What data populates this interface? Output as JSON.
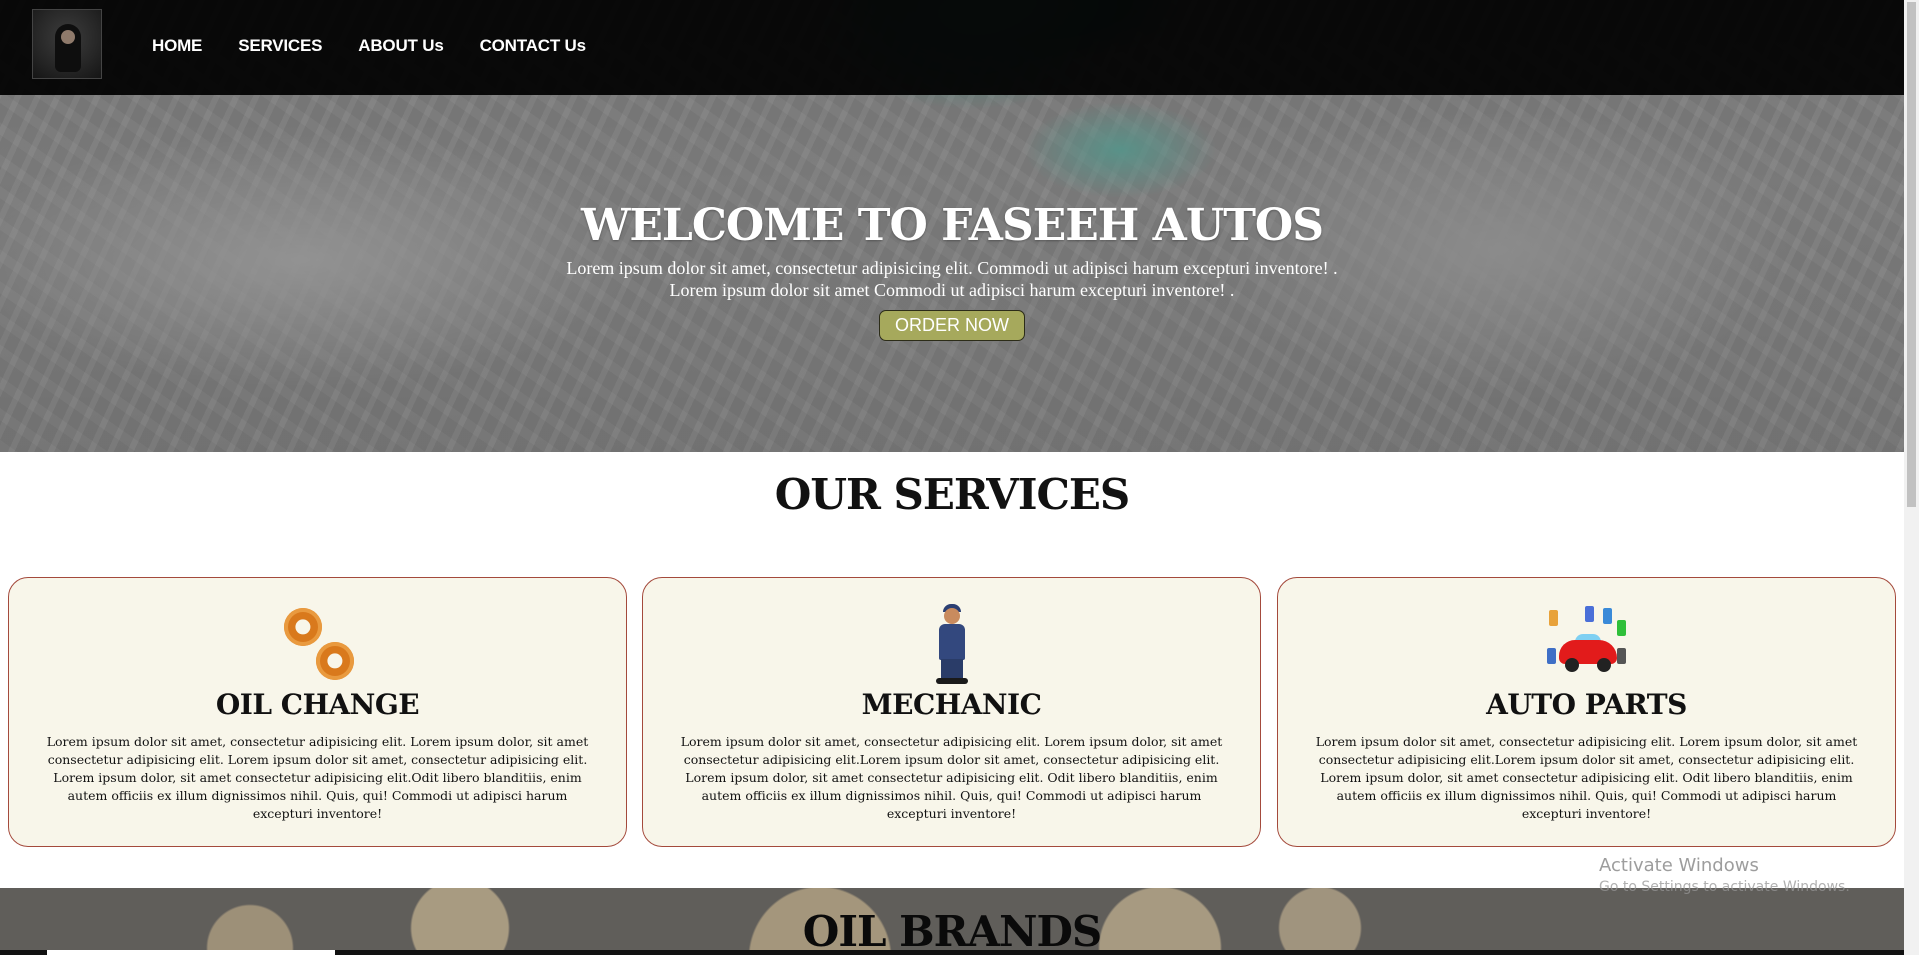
{
  "nav": {
    "items": [
      {
        "label": "HOME"
      },
      {
        "label": "SERVICES"
      },
      {
        "label": "ABOUT Us"
      },
      {
        "label": "CONTACT Us"
      }
    ]
  },
  "hero": {
    "title": "WELCOME TO FASEEH AUTOS",
    "line1": "Lorem ipsum dolor sit amet, consectetur adipisicing elit. Commodi ut adipisci harum excepturi inventore! .",
    "line2": "Lorem ipsum dolor sit amet Commodi ut adipisci harum excepturi inventore! .",
    "button": "ORDER NOW"
  },
  "services": {
    "title": "OUR SERVICES",
    "cards": [
      {
        "icon": "gears-icon",
        "title": "OIL CHANGE",
        "text": "Lorem ipsum dolor sit amet, consectetur adipisicing elit. Lorem ipsum dolor, sit amet consectetur adipisicing elit. Lorem ipsum dolor sit amet, consectetur adipisicing elit. Lorem ipsum dolor, sit amet consectetur adipisicing elit.Odit libero blanditiis, enim autem officiis ex illum dignissimos nihil. Quis, qui! Commodi ut adipisci harum excepturi inventore!"
      },
      {
        "icon": "mechanic-icon",
        "title": "MECHANIC",
        "text": "Lorem ipsum dolor sit amet, consectetur adipisicing elit. Lorem ipsum dolor, sit amet consectetur adipisicing elit.Lorem ipsum dolor sit amet, consectetur adipisicing elit. Lorem ipsum dolor, sit amet consectetur adipisicing elit. Odit libero blanditiis, enim autem officiis ex illum dignissimos nihil. Quis, qui! Commodi ut adipisci harum excepturi inventore!"
      },
      {
        "icon": "auto-parts-icon",
        "title": "AUTO PARTS",
        "text": "Lorem ipsum dolor sit amet, consectetur adipisicing elit. Lorem ipsum dolor, sit amet consectetur adipisicing elit.Lorem ipsum dolor sit amet, consectetur adipisicing elit. Lorem ipsum dolor, sit amet consectetur adipisicing elit. Odit libero blanditiis, enim autem officiis ex illum dignissimos nihil. Quis, qui! Commodi ut adipisci harum excepturi inventore!"
      }
    ]
  },
  "brands": {
    "title": "OIL BRANDS"
  },
  "watermark": {
    "line1": "Activate Windows",
    "line2": "Go to Settings to activate Windows."
  },
  "colors": {
    "navbar": "#000000",
    "button": "#a6a95c",
    "card_bg": "#f8f6ea",
    "card_border": "#a44a3c"
  }
}
